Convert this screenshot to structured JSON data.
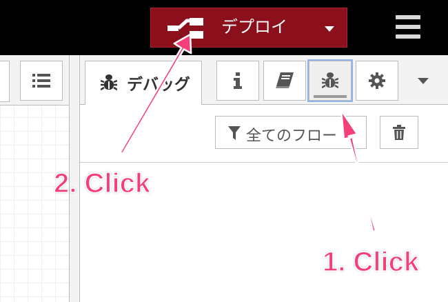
{
  "header": {
    "deploy_label": "デプロイ"
  },
  "sidebar": {
    "debug_tab_label": "デバッグ",
    "filter_label": "全てのフロー"
  },
  "annotations": {
    "step1": "1. Click",
    "step2": "2. Click"
  },
  "colors": {
    "deploy_bg": "#8c101c",
    "annotation": "#f43f78",
    "header_bg": "#000000",
    "selected_outline": "#8fb4e6"
  },
  "icons": {
    "deploy": "deploy-icon",
    "menu": "hamburger-menu-icon",
    "list": "list-icon",
    "debug_tab": "bug-icon",
    "info": "info-icon",
    "help": "book-icon",
    "debug": "bug-icon",
    "config": "gear-icon",
    "filter": "filter-icon",
    "clear": "trash-icon"
  }
}
